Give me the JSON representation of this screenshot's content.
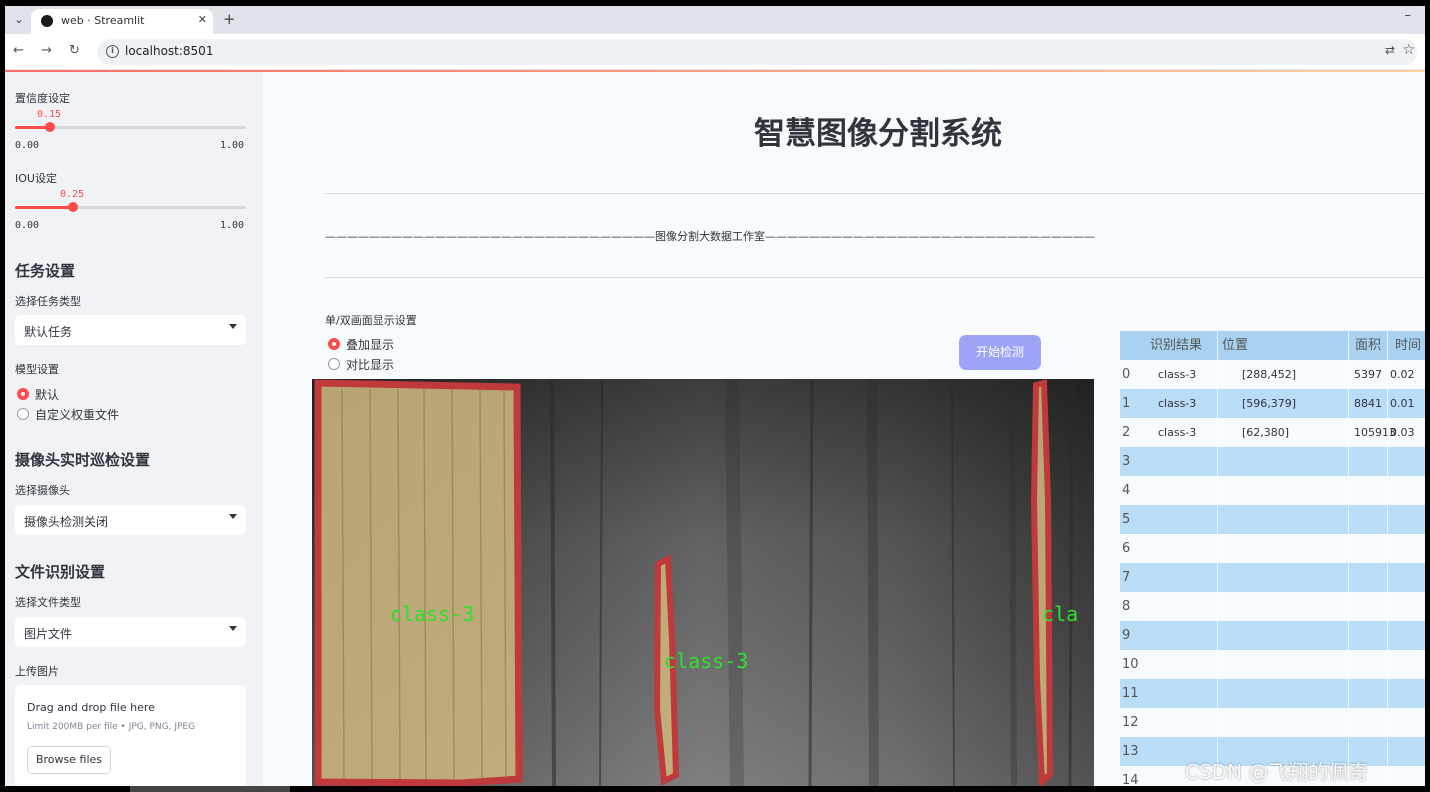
{
  "browser": {
    "tab_title": "web · Streamlit",
    "url": "localhost:8501"
  },
  "sidebar": {
    "confidence": {
      "label": "置信度设定",
      "value": "0.15",
      "value_num": 0.15,
      "min": "0.00",
      "max": "1.00"
    },
    "iou": {
      "label": "IOU设定",
      "value": "0.25",
      "value_num": 0.25,
      "min": "0.00",
      "max": "1.00"
    },
    "task": {
      "heading": "任务设置",
      "select_label": "选择任务类型",
      "selected": "默认任务"
    },
    "model": {
      "label": "模型设置",
      "options": [
        "默认",
        "自定义权重文件"
      ],
      "selected_index": 0
    },
    "camera": {
      "heading": "摄像头实时巡检设置",
      "select_label": "选择摄像头",
      "selected": "摄像头检测关闭"
    },
    "file": {
      "heading": "文件识别设置",
      "select_label": "选择文件类型",
      "selected": "图片文件",
      "upload_label": "上传图片"
    },
    "uploader": {
      "drag_text": "Drag and drop file here",
      "limit_text": "Limit 200MB per file • JPG, PNG, JPEG",
      "browse_label": "Browse files"
    }
  },
  "main": {
    "title": "智慧图像分割系统",
    "subtitle": "——————————————————————————————图像分割大数据工作室——————————————————————————————",
    "display_label": "单/双画面显示设置",
    "display_options": [
      "叠加显示",
      "对比显示"
    ],
    "display_selected_index": 0,
    "start_button": "开始检测",
    "image_labels": [
      "class-3",
      "class-3",
      "cla"
    ]
  },
  "results": {
    "headers": [
      "",
      "识别结果",
      "位置",
      "面积",
      "时间"
    ],
    "rows": [
      [
        "0",
        "class-3",
        "[288,452]",
        "5397",
        "0.02"
      ],
      [
        "1",
        "class-3",
        "[596,379]",
        "8841",
        "0.01"
      ],
      [
        "2",
        "class-3",
        "[62,380]",
        "105913",
        "0.03"
      ],
      [
        "3",
        "",
        "",
        "",
        ""
      ],
      [
        "4",
        "",
        "",
        "",
        ""
      ],
      [
        "5",
        "",
        "",
        "",
        ""
      ],
      [
        "6",
        "",
        "",
        "",
        ""
      ],
      [
        "7",
        "",
        "",
        "",
        ""
      ],
      [
        "8",
        "",
        "",
        "",
        ""
      ],
      [
        "9",
        "",
        "",
        "",
        ""
      ],
      [
        "10",
        "",
        "",
        "",
        ""
      ],
      [
        "11",
        "",
        "",
        "",
        ""
      ],
      [
        "12",
        "",
        "",
        "",
        ""
      ],
      [
        "13",
        "",
        "",
        "",
        ""
      ],
      [
        "14",
        "",
        "",
        "",
        ""
      ]
    ]
  },
  "watermark": "CSDN @飞翔的佩奇",
  "colors": {
    "accent": "#ff4b4b",
    "button": "#9ea4f5",
    "table_stripe": "#b9dcf7",
    "table_header": "#a9d2f2",
    "mask_fill": "#c9b47c",
    "mask_outline": "#c0393b",
    "label": "#2ee02e"
  }
}
